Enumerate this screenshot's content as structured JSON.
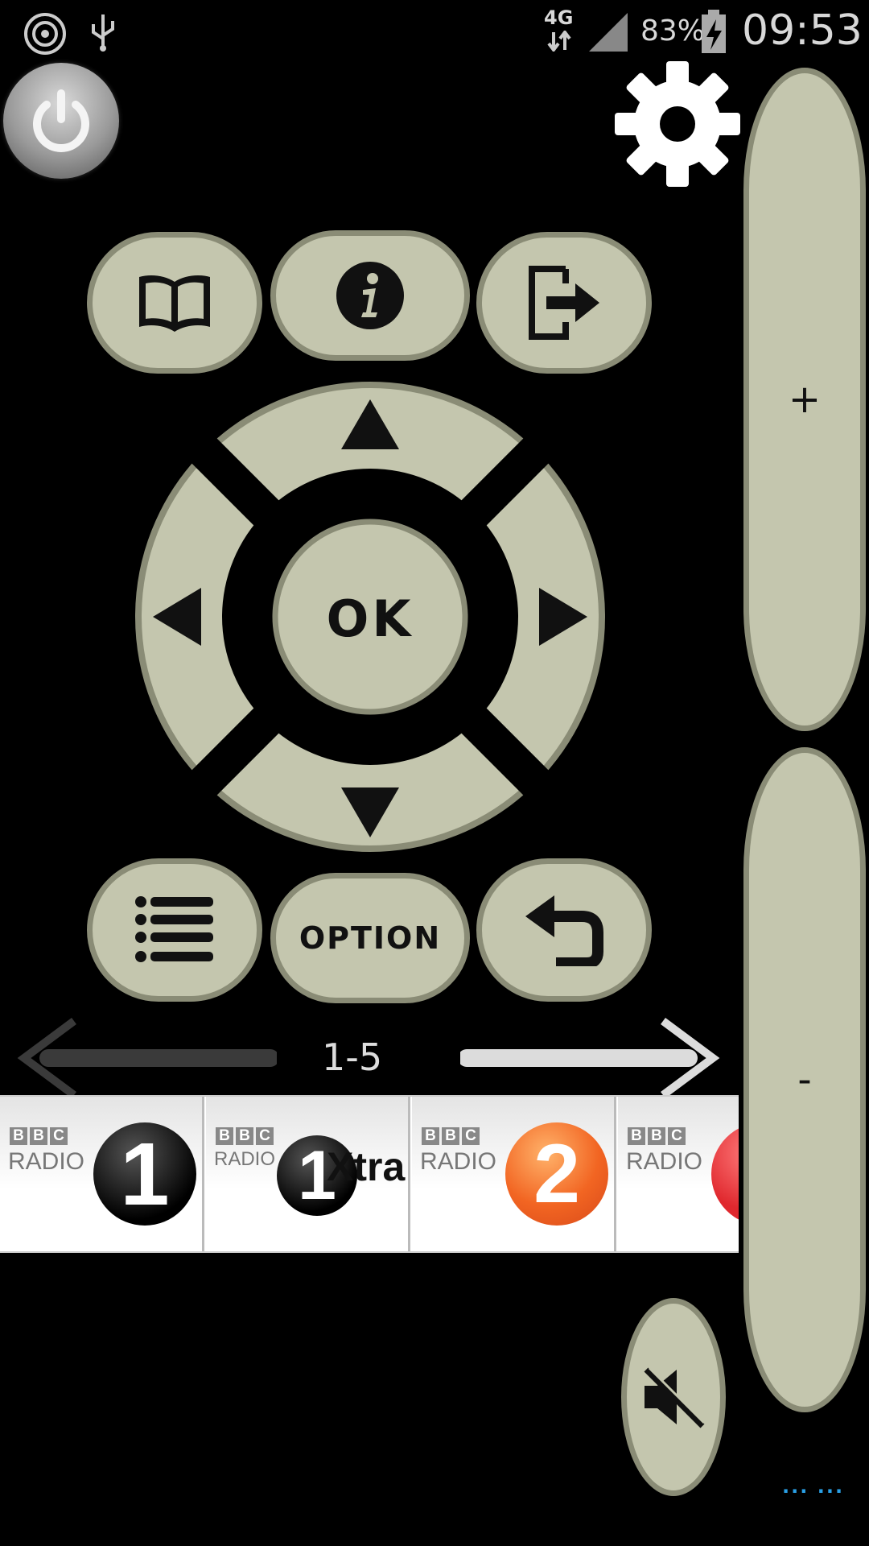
{
  "status_bar": {
    "network": "4G",
    "battery_pct": "83%",
    "time": "09:53",
    "icons": [
      "wifi-hotspot-icon",
      "usb-icon",
      "data-arrows-icon",
      "signal-icon",
      "battery-charging-icon"
    ]
  },
  "remote": {
    "ok_label": "OK",
    "option_label": "OPTION",
    "volume_up_label": "+",
    "volume_down_label": "-",
    "page_indicator": "1-5",
    "button_color": "#c4c6ae",
    "border_color": "#8a8c76"
  },
  "stations": [
    {
      "brand_letters": [
        "B",
        "B",
        "C"
      ],
      "radio_word": "RADIO",
      "number": "1",
      "color": "#111111"
    },
    {
      "brand_letters": [
        "B",
        "B",
        "C"
      ],
      "radio_word": "RADIO",
      "number": "1",
      "suffix": "Xtra",
      "color": "#111111"
    },
    {
      "brand_letters": [
        "B",
        "B",
        "C"
      ],
      "radio_word": "RADIO",
      "number": "2",
      "color": "#f26522"
    },
    {
      "brand_letters": [
        "B",
        "B",
        "C"
      ],
      "radio_word": "RADIO",
      "number": "",
      "color": "#e0282e"
    }
  ],
  "footer": {
    "dots": "... ..."
  }
}
